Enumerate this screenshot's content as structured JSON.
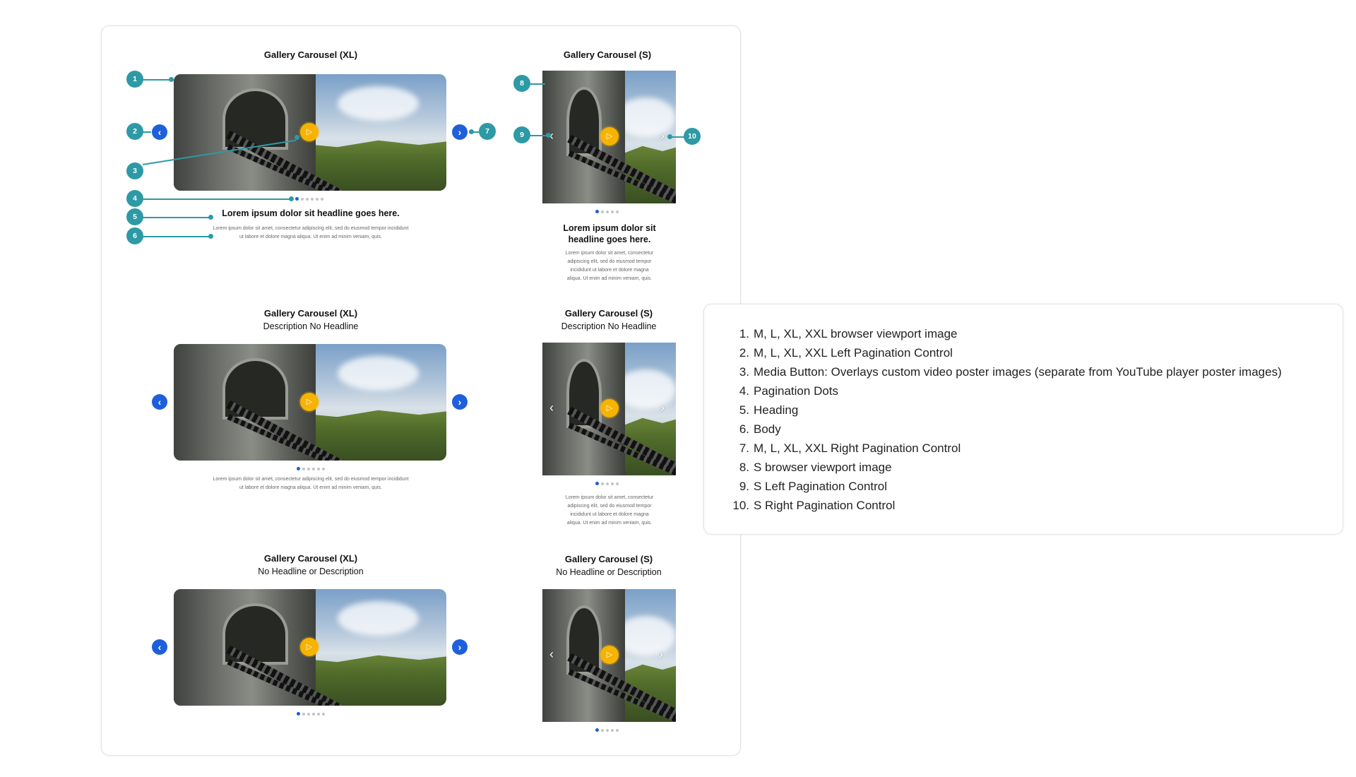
{
  "panels": {
    "xl_1": {
      "title": "Gallery Carousel (XL)",
      "subtitle": ""
    },
    "s_1": {
      "title": "Gallery Carousel (S)",
      "subtitle": ""
    },
    "xl_2": {
      "title": "Gallery Carousel (XL)",
      "subtitle": "Description No Headline"
    },
    "s_2": {
      "title": "Gallery Carousel (S)",
      "subtitle": "Description No Headline"
    },
    "xl_3": {
      "title": "Gallery Carousel (XL)",
      "subtitle": "No Headline or Description"
    },
    "s_3": {
      "title": "Gallery Carousel (S)",
      "subtitle": "No Headline or Description"
    }
  },
  "content": {
    "headline": "Lorem ipsum dolor sit headline goes here.",
    "headline_small_1": "Lorem ipsum dolor sit",
    "headline_small_2": "headline goes here.",
    "body_xl_1": "Lorem ipsum dolor sit amet, consectetur adipiscing elit, sed do eiusmod tempor incididunt",
    "body_xl_2": "ut labore et dolore magna aliqua. Ut enim ad minim veniam, quis.",
    "body_s_1": "Lorem ipsum dolor sit amet, consectetur",
    "body_s_2": "adipiscing elit, sed do eiusmod tempor",
    "body_s_3": "incididunt ut labore et dolore magna",
    "body_s_4": "aliqua. Ut enim ad minim veniam, quis."
  },
  "callouts": [
    "1",
    "2",
    "3",
    "4",
    "5",
    "6",
    "7",
    "8",
    "9",
    "10"
  ],
  "legend": [
    {
      "num": "1.",
      "text": "M, L, XL, XXL browser viewport image"
    },
    {
      "num": "2.",
      "text": "M, L, XL, XXL Left Pagination Control"
    },
    {
      "num": "3.",
      "text": "Media Button: Overlays custom video poster images (separate from YouTube player poster images)"
    },
    {
      "num": "4.",
      "text": "Pagination Dots"
    },
    {
      "num": "5.",
      "text": "Heading"
    },
    {
      "num": "6.",
      "text": "Body"
    },
    {
      "num": "7.",
      "text": "M, L, XL, XXL Right Pagination Control"
    },
    {
      "num": "8.",
      "text": "S browser viewport image"
    },
    {
      "num": "9.",
      "text": "S Left Pagination Control"
    },
    {
      "num": "10.",
      "text": "S Right Pagination Control"
    }
  ],
  "icons": {
    "play": "▷",
    "chevron_left": "‹",
    "chevron_right": "›"
  },
  "pagination": {
    "total_dots": 6,
    "active_index": 0
  },
  "colors": {
    "callout": "#2d9aa6",
    "nav_button": "#1e5fdc",
    "play_button": "#f6b300",
    "dot_active": "#1e5fdc",
    "dot_inactive": "#c4c4c4"
  }
}
